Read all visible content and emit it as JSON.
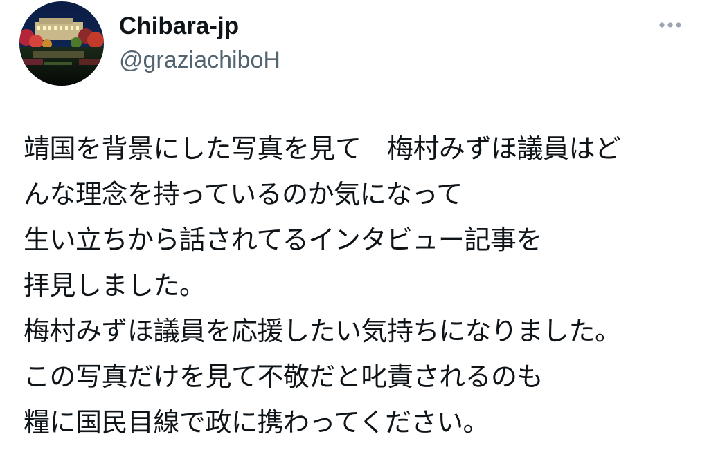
{
  "author": {
    "display_name": "Chibara-jp",
    "handle": "@graziachiboH",
    "avatar_icon": "night-illuminated-building-photo"
  },
  "actions": {
    "more_icon": "more-horizontal-icon"
  },
  "tweet": {
    "lines": [
      "靖国を背景にした写真を見て　梅村みずほ議員はど",
      "んな理念を持っているのか気になって",
      "生い立ちから話されてるインタビュー記事を",
      "拝見しました。",
      "梅村みずほ議員を応援したい気持ちになりました。",
      "この写真だけを見て不敬だと叱責されるのも",
      "糧に国民目線で政に携わってください。"
    ]
  },
  "colors": {
    "text": "#0f1419",
    "secondary_text": "#536471",
    "icon": "#9aa5b1",
    "background": "#ffffff"
  }
}
